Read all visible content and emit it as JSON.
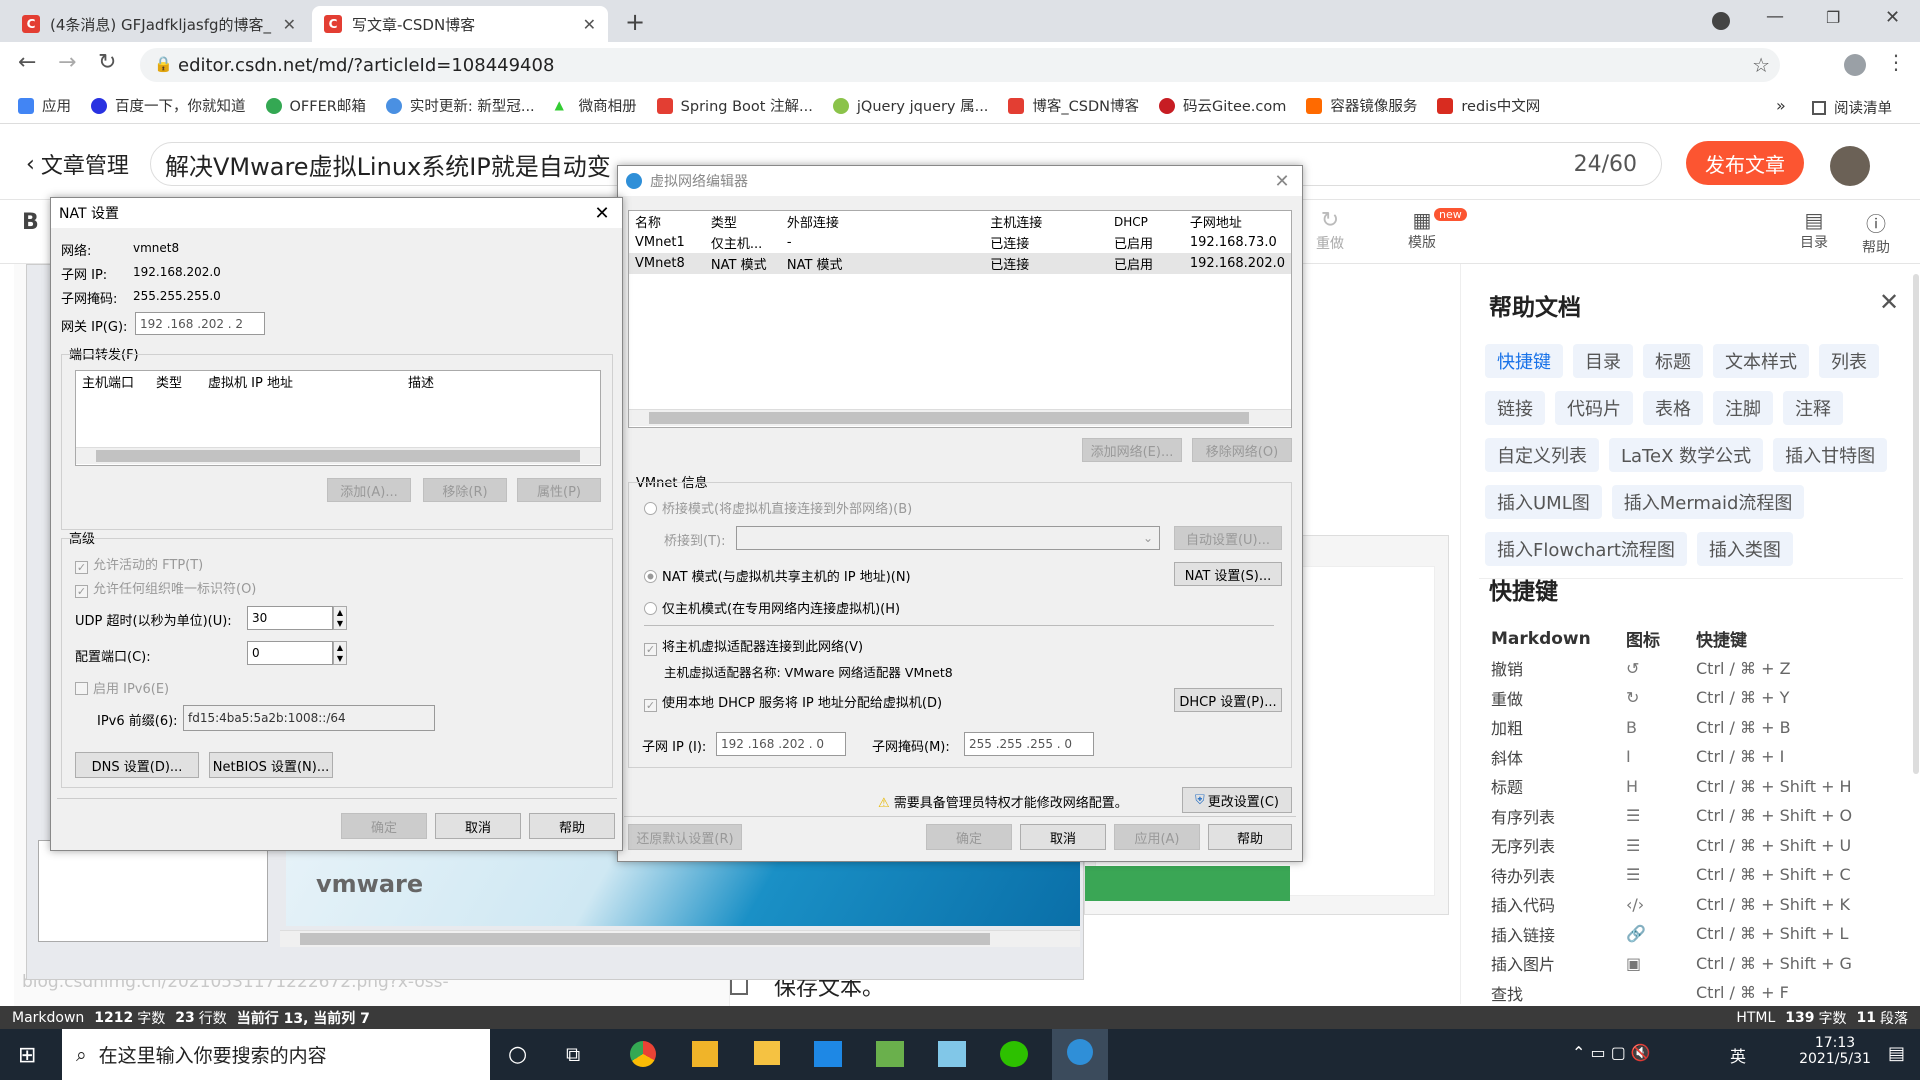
{
  "browser": {
    "tabs": [
      {
        "label": "(4条消息) GFJadfkljasfg的博客_"
      },
      {
        "label": "写文章-CSDN博客"
      }
    ],
    "url": "editor.csdn.net/md/?articleId=108449408",
    "bookmarks": [
      "应用",
      "百度一下，你就知道",
      "OFFER邮箱",
      "实时更新: 新型冠...",
      "微商相册",
      "Spring Boot 注解...",
      "jQuery jquery 属...",
      "博客_CSDN博客",
      "码云Gitee.com",
      "容器镜像服务",
      "redis中文网"
    ],
    "reading_list": "阅读清单",
    "more": "»"
  },
  "editor": {
    "back_label": "文章管理",
    "title_value": "解决VMware虚拟Linux系统IP就是自动变",
    "title_count": "24/60",
    "publish_label": "发布文章",
    "toolbar": {
      "redo": "重做",
      "template": "模版",
      "new_badge": "new",
      "toc": "目录",
      "help": "帮助"
    },
    "body_line": "保存文本。",
    "url_fragment": "blog.csdnimg.cn/20210531171222672.png?x-oss-",
    "vmware_logo": "vmware"
  },
  "help": {
    "title": "帮助文档",
    "chips": [
      "快捷键",
      "目录",
      "标题",
      "文本样式",
      "列表",
      "链接",
      "代码片",
      "表格",
      "注脚",
      "注释",
      "自定义列表",
      "LaTeX 数学公式",
      "插入甘特图",
      "插入UML图",
      "插入Mermaid流程图",
      "插入Flowchart流程图",
      "插入类图"
    ],
    "shortcuts_title": "快捷键",
    "cols": [
      "Markdown",
      "图标",
      "快捷键"
    ],
    "rows": [
      {
        "name": "撤销",
        "icon": "↺",
        "key": "Ctrl / ⌘ + Z"
      },
      {
        "name": "重做",
        "icon": "↻",
        "key": "Ctrl / ⌘ + Y"
      },
      {
        "name": "加粗",
        "icon": "B",
        "key": "Ctrl / ⌘ + B"
      },
      {
        "name": "斜体",
        "icon": "I",
        "key": "Ctrl / ⌘ + I"
      },
      {
        "name": "标题",
        "icon": "H",
        "key": "Ctrl / ⌘ + Shift + H"
      },
      {
        "name": "有序列表",
        "icon": "☰",
        "key": "Ctrl / ⌘ + Shift + O"
      },
      {
        "name": "无序列表",
        "icon": "☰",
        "key": "Ctrl / ⌘ + Shift + U"
      },
      {
        "name": "待办列表",
        "icon": "☰",
        "key": "Ctrl / ⌘ + Shift + C"
      },
      {
        "name": "插入代码",
        "icon": "‹/›",
        "key": "Ctrl / ⌘ + Shift + K"
      },
      {
        "name": "插入链接",
        "icon": "🔗",
        "key": "Ctrl / ⌘ + Shift + L"
      },
      {
        "name": "插入图片",
        "icon": "▣",
        "key": "Ctrl / ⌘ + Shift + G"
      },
      {
        "name": "查找",
        "icon": "",
        "key": "Ctrl / ⌘ + F"
      }
    ]
  },
  "statusbar": {
    "left": "Markdown",
    "chars": "1212",
    "chars_unit": "字数",
    "lines": "23",
    "lines_unit": "行数",
    "cursor": "当前行 13, 当前列 7",
    "right_mode": "HTML",
    "right_chars": "139",
    "right_chars_unit": "字数",
    "right_paras": "11",
    "right_paras_unit": "段落"
  },
  "taskbar": {
    "search_placeholder": "在这里输入你要搜索的内容",
    "time": "17:13",
    "date": "2021/5/31",
    "ime": "英"
  },
  "nat": {
    "title": "NAT 设置",
    "network_label": "网络:",
    "network": "vmnet8",
    "subnet_ip_label": "子网 IP:",
    "subnet_ip": "192.168.202.0",
    "mask_label": "子网掩码:",
    "mask": "255.255.255.0",
    "gateway_label": "网关 IP(G):",
    "gateway": "192 .168 .202 .  2",
    "pf_group": "端口转发(F)",
    "pf_cols": [
      "主机端口",
      "类型",
      "虚拟机 IP 地址",
      "描述"
    ],
    "add": "添加(A)...",
    "remove": "移除(R)",
    "props": "属性(P)",
    "adv_group": "高级",
    "ftp": "允许活动的 FTP(T)",
    "oui": "允许任何组织唯一标识符(O)",
    "udp_label": "UDP 超时(以秒为单位)(U):",
    "udp": "30",
    "cfg_port_label": "配置端口(C):",
    "cfg_port": "0",
    "ipv6": "启用 IPv6(E)",
    "ipv6_prefix_label": "IPv6 前缀(6):",
    "ipv6_prefix": "fd15:4ba5:5a2b:1008::/64",
    "dns": "DNS 设置(D)...",
    "netbios": "NetBIOS 设置(N)...",
    "ok": "确定",
    "cancel": "取消",
    "help": "帮助"
  },
  "vne": {
    "title": "虚拟网络编辑器",
    "cols": [
      "名称",
      "类型",
      "外部连接",
      "主机连接",
      "DHCP",
      "子网地址"
    ],
    "rows": [
      {
        "name": "VMnet1",
        "type": "仅主机...",
        "ext": "-",
        "host": "已连接",
        "dhcp": "已启用",
        "subnet": "192.168.73.0"
      },
      {
        "name": "VMnet8",
        "type": "NAT 模式",
        "ext": "NAT 模式",
        "host": "已连接",
        "dhcp": "已启用",
        "subnet": "192.168.202.0"
      }
    ],
    "add_net": "添加网络(E)...",
    "rm_net": "移除网络(O)",
    "info_group": "VMnet 信息",
    "bridge": "桥接模式(将虚拟机直接连接到外部网络)(B)",
    "bridge_to": "桥接到(T):",
    "auto": "自动设置(U)...",
    "nat_mode": "NAT 模式(与虚拟机共享主机的 IP 地址)(N)",
    "nat_btn": "NAT 设置(S)...",
    "host_only": "仅主机模式(在专用网络内连接虚拟机)(H)",
    "connect_adapter": "将主机虚拟适配器连接到此网络(V)",
    "adapter_name": "主机虚拟适配器名称: VMware 网络适配器 VMnet8",
    "dhcp_use": "使用本地 DHCP 服务将 IP 地址分配给虚拟机(D)",
    "dhcp_btn": "DHCP 设置(P)...",
    "subnet_label": "子网 IP (I):",
    "subnet": "192 .168 .202 .  0",
    "mask_label": "子网掩码(M):",
    "mask": "255 .255 .255 .  0",
    "admin_note": "需要具备管理员特权才能修改网络配置。",
    "change": "更改设置(C)",
    "restore": "还原默认设置(R)",
    "ok": "确定",
    "cancel": "取消",
    "apply": "应用(A)",
    "help": "帮助"
  }
}
